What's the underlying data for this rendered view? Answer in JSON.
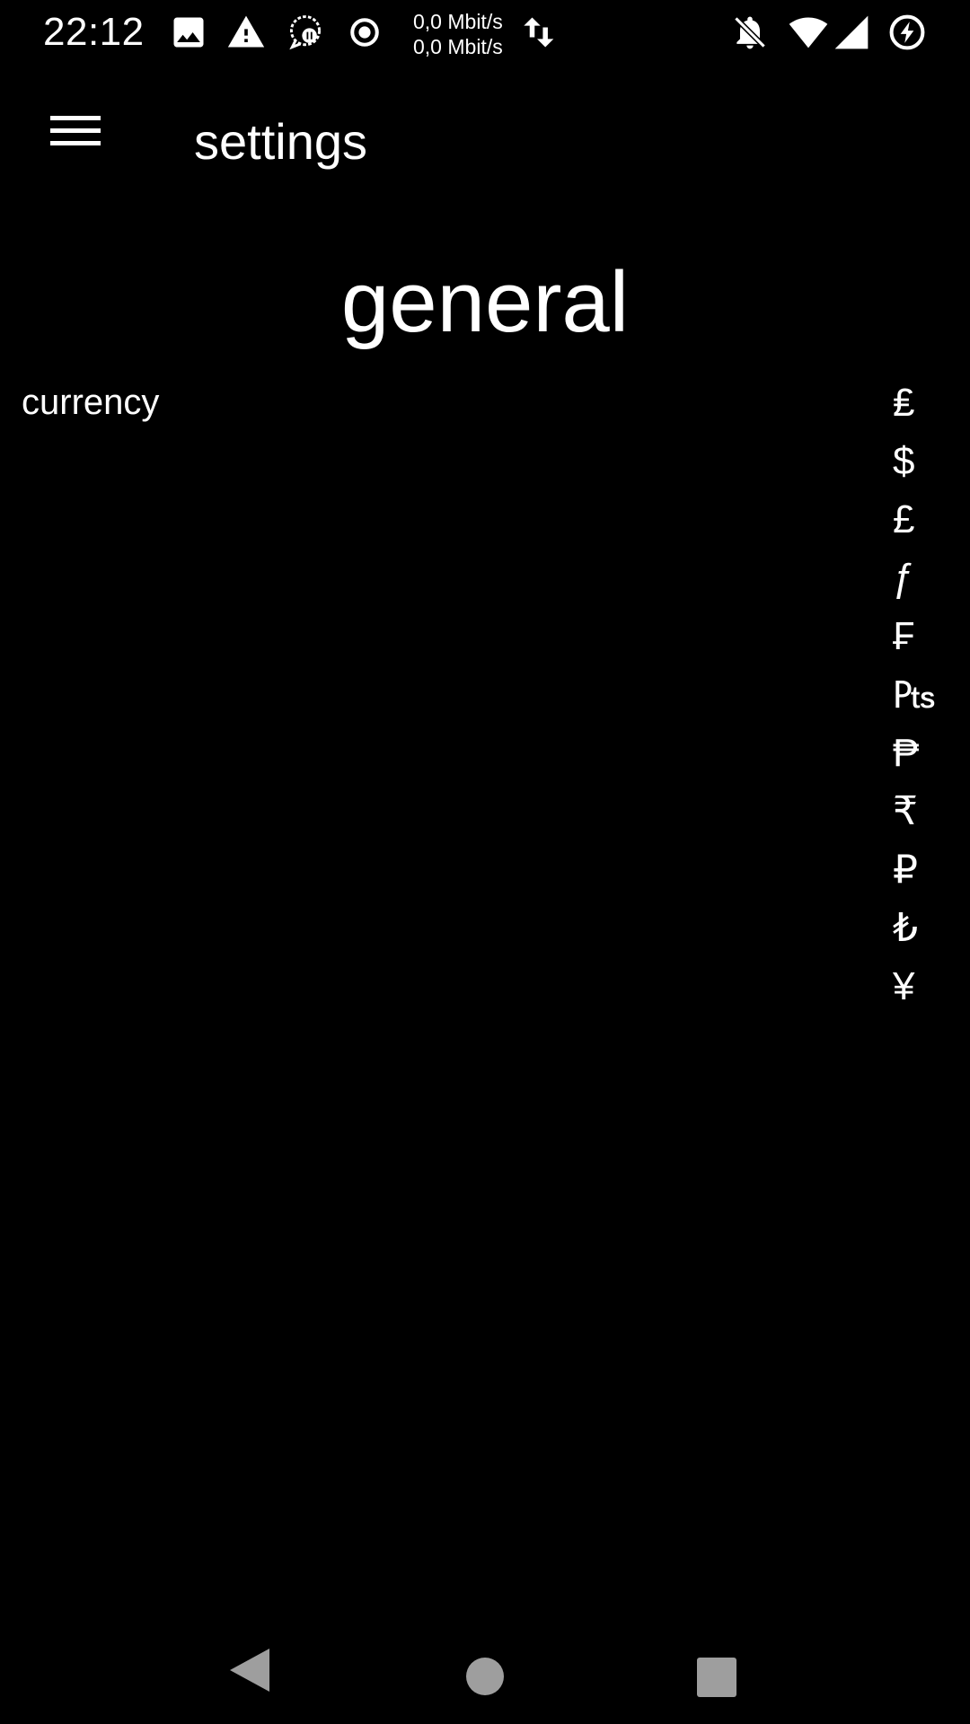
{
  "status_bar": {
    "time": "22:12",
    "net_up": "0,0 Mbit/s",
    "net_down": "0,0 Mbit/s",
    "left_icons": [
      "image-icon",
      "warning-icon",
      "chat-bubble-icon",
      "radio-button-icon",
      "data-transfer-icon"
    ],
    "right_icons": [
      "notifications-off-icon",
      "wifi-icon",
      "signal-icon",
      "battery-charging-icon"
    ]
  },
  "toolbar": {
    "menu_icon": "hamburger-menu-icon",
    "title": "settings"
  },
  "section": {
    "title": "general"
  },
  "currency": {
    "label": "currency",
    "options": [
      "₤",
      "$",
      "£",
      "ƒ",
      "₣",
      "₧",
      "₱",
      "₹",
      "₽",
      "₺",
      "¥"
    ]
  },
  "nav_bar": {
    "icons": [
      "back-icon",
      "home-icon",
      "recents-icon"
    ],
    "color": "#9e9e9e"
  },
  "colors": {
    "background": "#000000",
    "text": "#ffffff"
  }
}
